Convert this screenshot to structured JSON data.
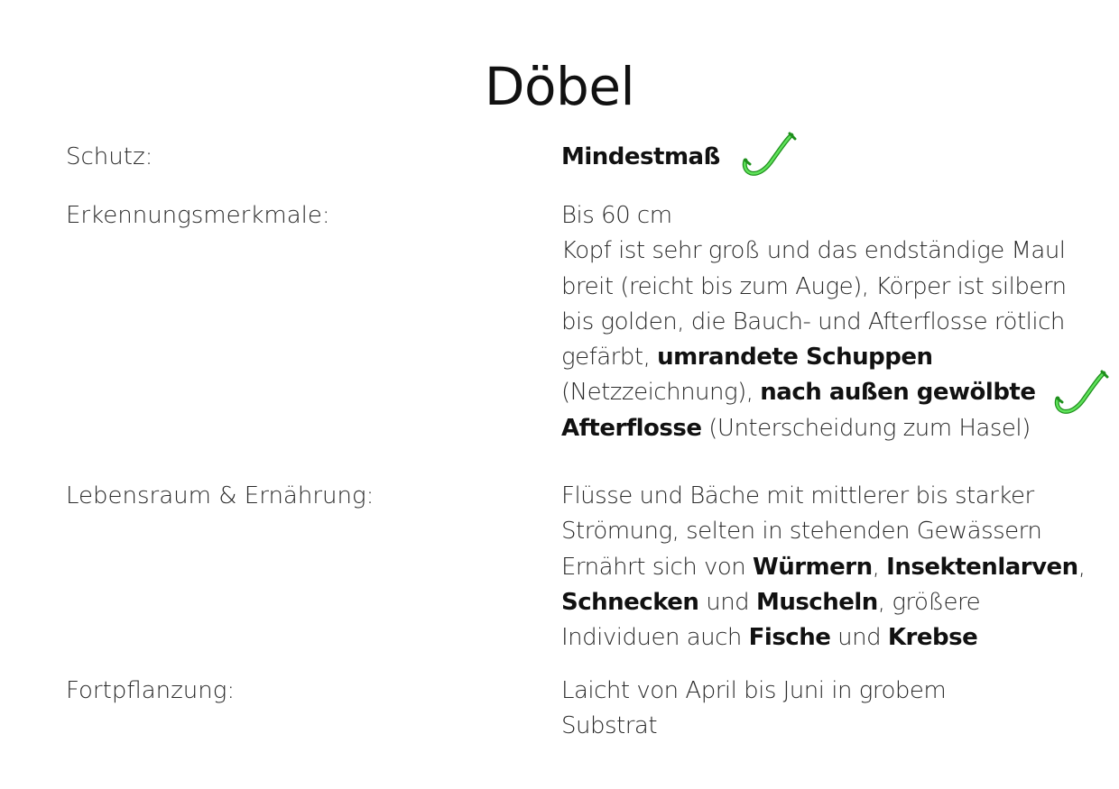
{
  "title": "Döbel",
  "accent_color": "#3cc83a",
  "rows": {
    "schutz": {
      "label": "Schutz:",
      "value": "Mindestmaß",
      "icon": "fish-hook-icon"
    },
    "erkennung": {
      "label": "Erkennungsmerkmale:",
      "l1": "Bis 60 cm",
      "l2": "Kopf ist sehr groß und das endständige Maul",
      "l3": "breit (reicht bis zum Auge), Körper ist silbern",
      "l4": "bis golden, die Bauch- und Afterflosse rötlich",
      "l5a": "gefärbt, ",
      "l5b": "umrandete Schuppen",
      "l6a": "(Netzzeichnung), ",
      "l6b": "nach außen gewölbte",
      "l7a": "Afterflosse",
      "l7b": " (Unterscheidung zum Hasel)",
      "icon": "fish-hook-icon"
    },
    "lebensraum": {
      "label": "Lebensraum & Ernährung:",
      "l1": "Flüsse und Bäche mit mittlerer bis starker",
      "l2": "Strömung, selten in stehenden Gewässern",
      "l3a": "Ernährt sich von ",
      "l3b": "Würmern",
      "l3c": ", ",
      "l3d": "Insektenlarven",
      "l3e": ",",
      "l4a": "Schnecken",
      "l4b": " und ",
      "l4c": "Muscheln",
      "l4d": ", größere",
      "l5a": "Individuen auch ",
      "l5b": "Fische",
      "l5c": " und ",
      "l5d": "Krebse"
    },
    "fortpflanzung": {
      "label": "Fortpflanzung:",
      "l1": "Laicht von April bis Juni in grobem",
      "l2": "Substrat"
    }
  }
}
